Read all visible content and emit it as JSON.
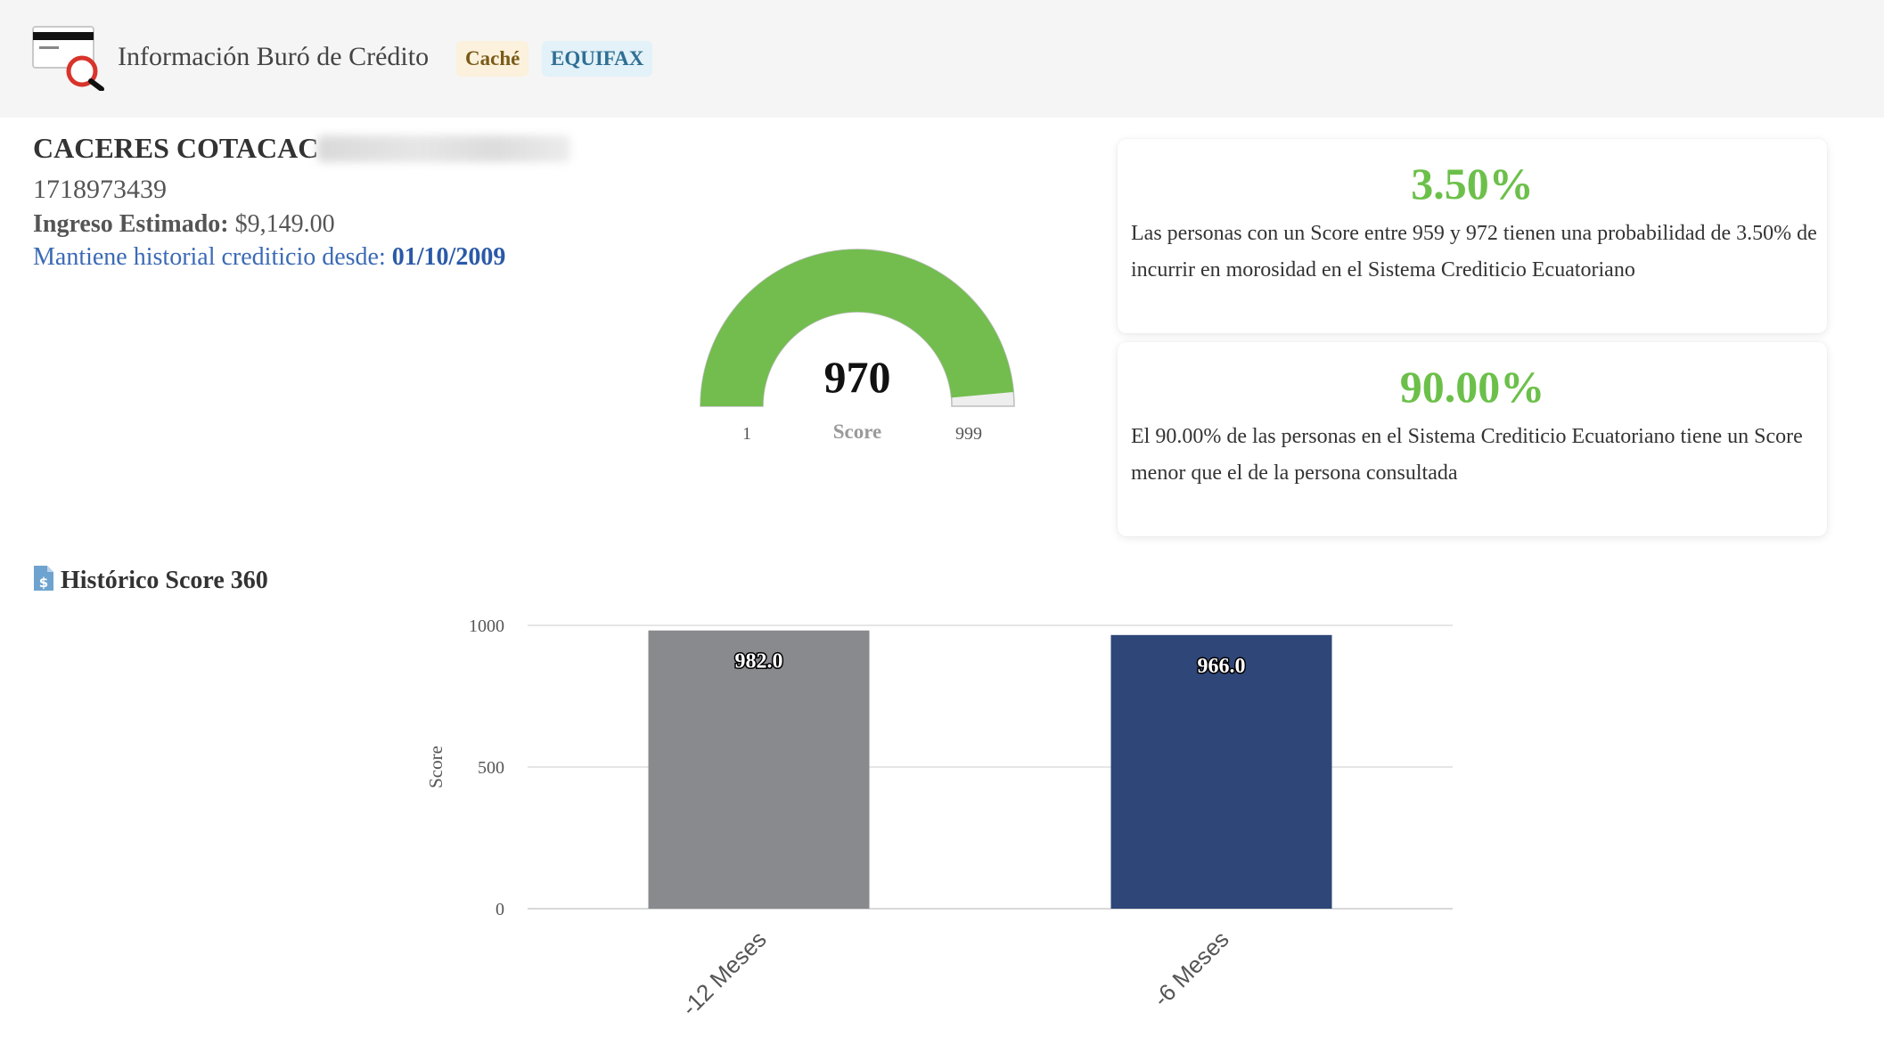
{
  "header": {
    "title": "Información Buró de Crédito",
    "badges": [
      "Caché",
      "EQUIFAX"
    ],
    "icon": "credit-card-search-icon"
  },
  "person": {
    "name": "CACERES COTACAC",
    "id_number": "1718973439",
    "income_label": "Ingreso Estimado:",
    "income_value": "$9,149.00",
    "history_label": "Mantiene historial crediticio desde:",
    "history_date": "01/10/2009"
  },
  "gauge": {
    "value": "970",
    "label": "Score",
    "min": "1",
    "max": "999",
    "fill_fraction": 0.971,
    "color": "#72bd4e"
  },
  "cards": [
    {
      "value": "3.50%",
      "text": "Las personas con un Score entre 959 y 972 tienen una probabilidad de 3.50% de incurrir en morosidad en el Sistema Crediticio Ecuatoriano"
    },
    {
      "value": "90.00%",
      "text": "El 90.00% de las personas en el Sistema Crediticio Ecuatoriano tiene un Score menor que el de la persona consultada"
    }
  ],
  "section": {
    "title": "Histórico Score 360",
    "icon": "document-dollar-icon"
  },
  "chart_data": {
    "type": "bar",
    "categories": [
      "-12 Meses",
      "-6 Meses"
    ],
    "values": [
      982.0,
      966.0
    ],
    "data_labels": [
      "982.0",
      "966.0"
    ],
    "colors": [
      "#898a8d",
      "#2f4678"
    ],
    "ylabel": "Score",
    "yticks": [
      "0",
      "500",
      "1000"
    ],
    "ylim": [
      0,
      1000
    ],
    "grid": true
  }
}
